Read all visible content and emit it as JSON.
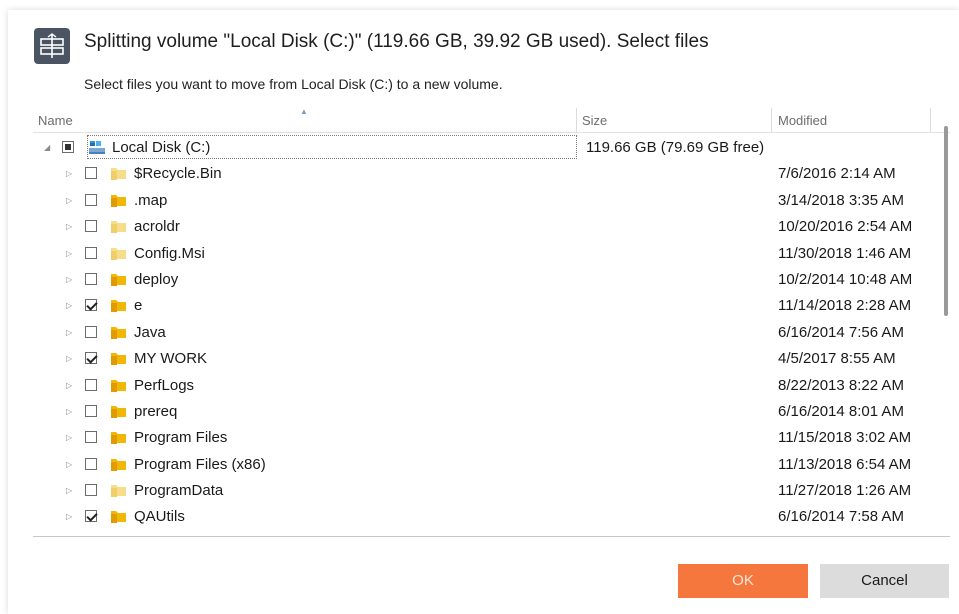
{
  "dialog": {
    "title": "Splitting volume \"Local Disk (C:)\" (119.66 GB, 39.92 GB used). Select files",
    "subtitle": "Select files you want to move from Local Disk (C:) to a new volume.",
    "icon": "split-volume-icon"
  },
  "columns": {
    "name": "Name",
    "size": "Size",
    "modified": "Modified"
  },
  "root": {
    "name": "Local Disk (C:)",
    "size": "119.66 GB (79.69 GB free)",
    "state": "partial",
    "icon": "drive-icon"
  },
  "items": [
    {
      "name": "$Recycle.Bin",
      "modified": "7/6/2016 2:14 AM",
      "checked": false,
      "hidden": true
    },
    {
      "name": ".map",
      "modified": "3/14/2018 3:35 AM",
      "checked": false,
      "hidden": false
    },
    {
      "name": "acroldr",
      "modified": "10/20/2016 2:54 AM",
      "checked": false,
      "hidden": true
    },
    {
      "name": "Config.Msi",
      "modified": "11/30/2018 1:46 AM",
      "checked": false,
      "hidden": true
    },
    {
      "name": "deploy",
      "modified": "10/2/2014 10:48 AM",
      "checked": false,
      "hidden": false
    },
    {
      "name": "e",
      "modified": "11/14/2018 2:28 AM",
      "checked": true,
      "hidden": false
    },
    {
      "name": "Java",
      "modified": "6/16/2014 7:56 AM",
      "checked": false,
      "hidden": false
    },
    {
      "name": "MY WORK",
      "modified": "4/5/2017 8:55 AM",
      "checked": true,
      "hidden": false
    },
    {
      "name": "PerfLogs",
      "modified": "8/22/2013 8:22 AM",
      "checked": false,
      "hidden": false
    },
    {
      "name": "prereq",
      "modified": "6/16/2014 8:01 AM",
      "checked": false,
      "hidden": false
    },
    {
      "name": "Program Files",
      "modified": "11/15/2018 3:02 AM",
      "checked": false,
      "hidden": false
    },
    {
      "name": "Program Files (x86)",
      "modified": "11/13/2018 6:54 AM",
      "checked": false,
      "hidden": false
    },
    {
      "name": "ProgramData",
      "modified": "11/27/2018 1:26 AM",
      "checked": false,
      "hidden": true
    },
    {
      "name": "QAUtils",
      "modified": "6/16/2014 7:58 AM",
      "checked": true,
      "hidden": false
    }
  ],
  "buttons": {
    "ok": "OK",
    "cancel": "Cancel"
  },
  "colors": {
    "ok_button": "#f5773e",
    "cancel_button": "#dcdcdc",
    "folder": "#f2b705",
    "folder_hidden": "#f7dc8a"
  }
}
